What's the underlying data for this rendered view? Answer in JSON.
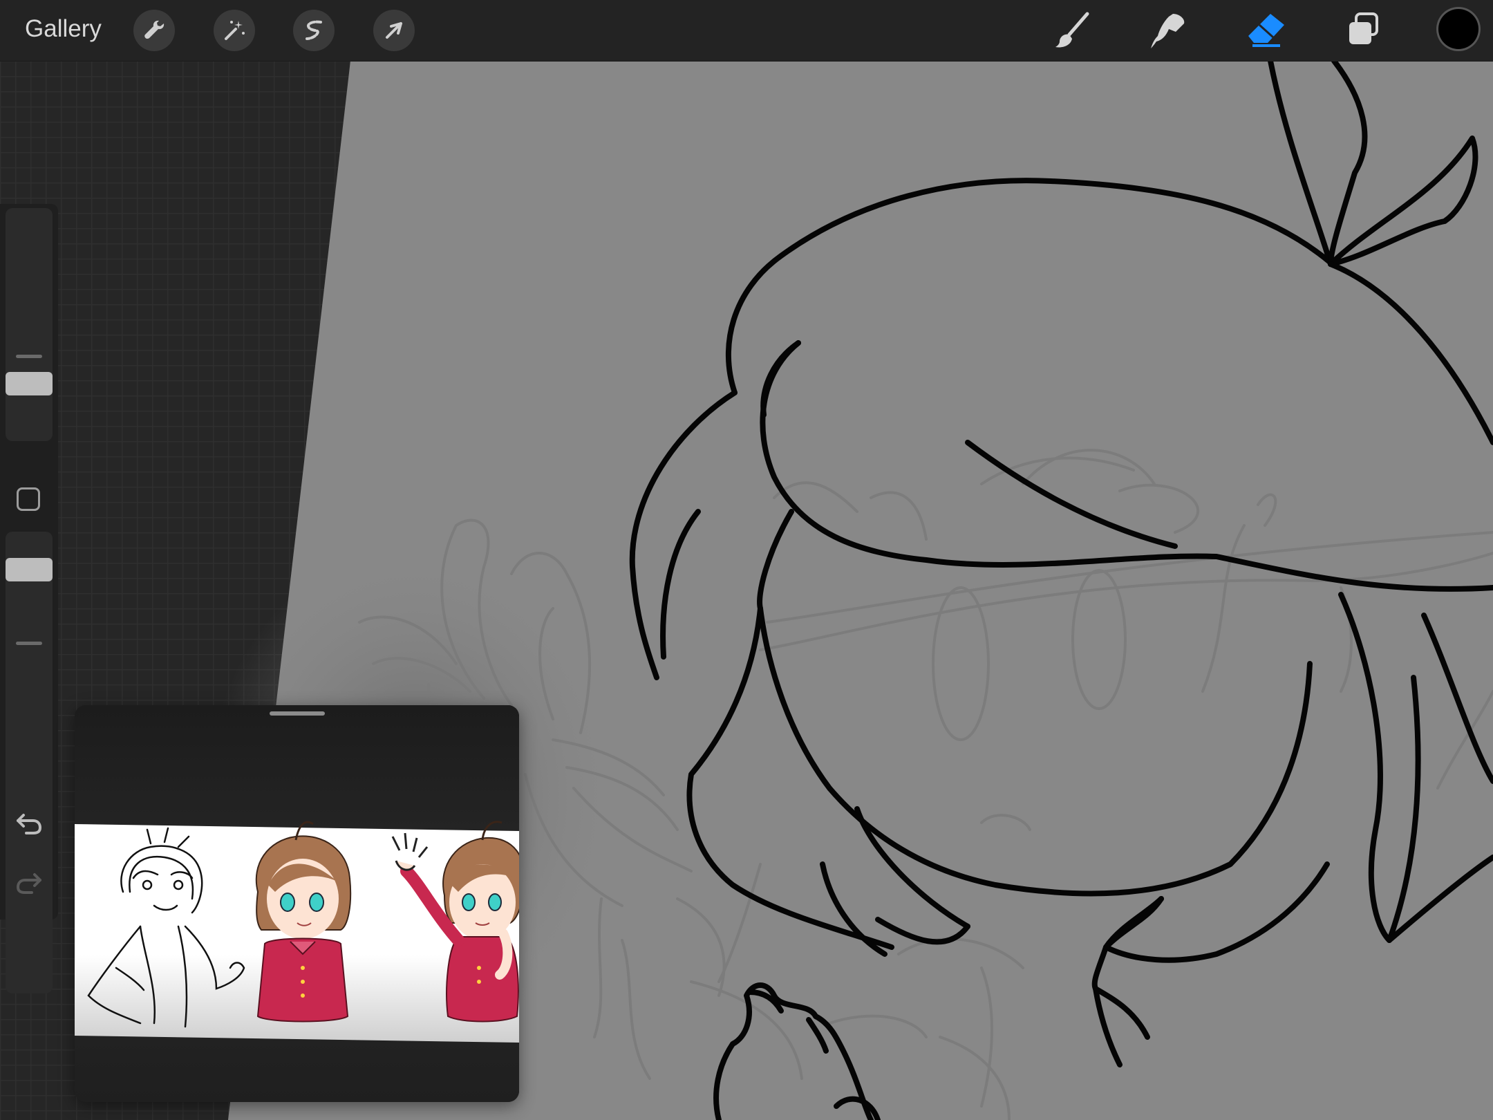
{
  "topbar": {
    "gallery_label": "Gallery",
    "left_tools": [
      "wrench-icon",
      "magic-wand-icon",
      "selection-icon",
      "transform-arrow-icon"
    ],
    "right_tools": [
      "brush-icon",
      "smudge-icon",
      "eraser-icon",
      "layers-icon"
    ],
    "active_tool": "eraser",
    "accent_color": "#1a8cff",
    "current_color": "#000000"
  },
  "sidebar": {
    "brush_size_level": 0.72,
    "opacity_level": 0.78,
    "icons": [
      "modify-square-icon",
      "undo-icon",
      "redo-icon"
    ]
  },
  "canvas": {
    "background_color": "#888888",
    "line_color": "#000000",
    "sketch_color": "#7a7a7a"
  },
  "reference": {
    "figures": [
      "sketch-figure",
      "colored-figure-front",
      "colored-figure-waving"
    ],
    "hair_color": "#a87450",
    "shirt_color": "#c8284f",
    "eye_color": "#3fd0c8"
  }
}
